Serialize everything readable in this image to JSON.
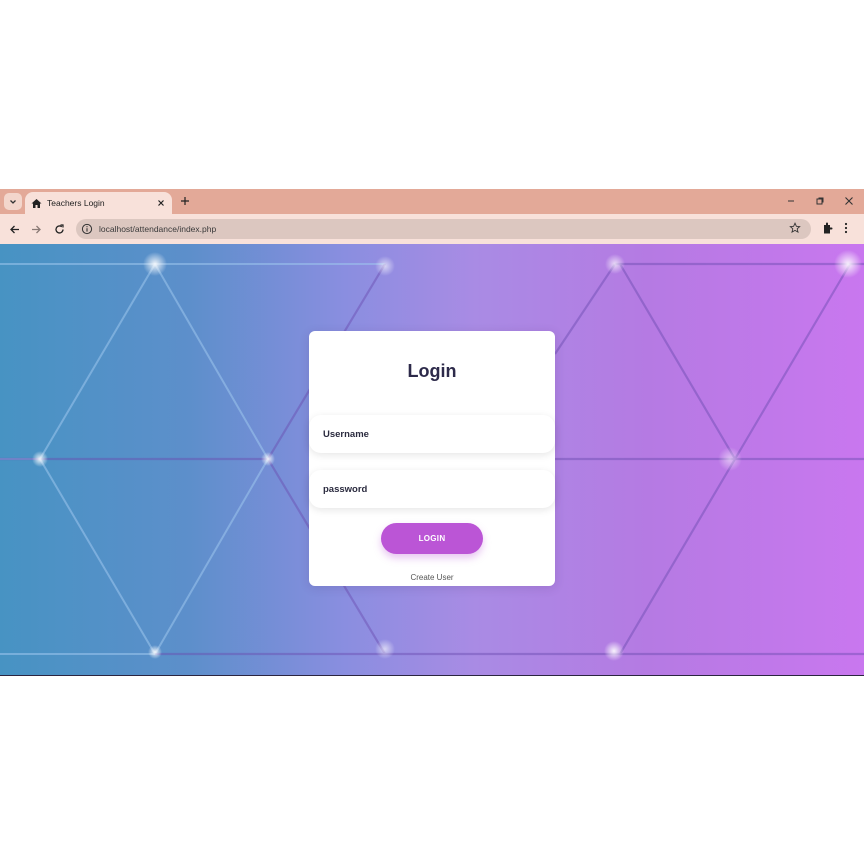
{
  "browser": {
    "tab_title": "Teachers Login",
    "url": "localhost/attendance/index.php"
  },
  "login": {
    "title": "Login",
    "username_placeholder": "Username",
    "password_placeholder": "password",
    "button_label": "LOGIN",
    "create_user_link": "Create User"
  },
  "icons": [
    "chevron-down-icon",
    "home-icon",
    "close-icon",
    "plus-icon",
    "minimize-icon",
    "restore-icon",
    "close-window-icon",
    "back-arrow-icon",
    "forward-arrow-icon",
    "reload-icon",
    "info-icon",
    "star-icon",
    "extensions-icon",
    "menu-dots-icon"
  ],
  "colors": {
    "tabstrip": "#e3a998",
    "toolbar": "#f8e1da",
    "login_button": "#bb55d6",
    "gradient_start": "#4793c3",
    "gradient_end": "#c977ef"
  }
}
